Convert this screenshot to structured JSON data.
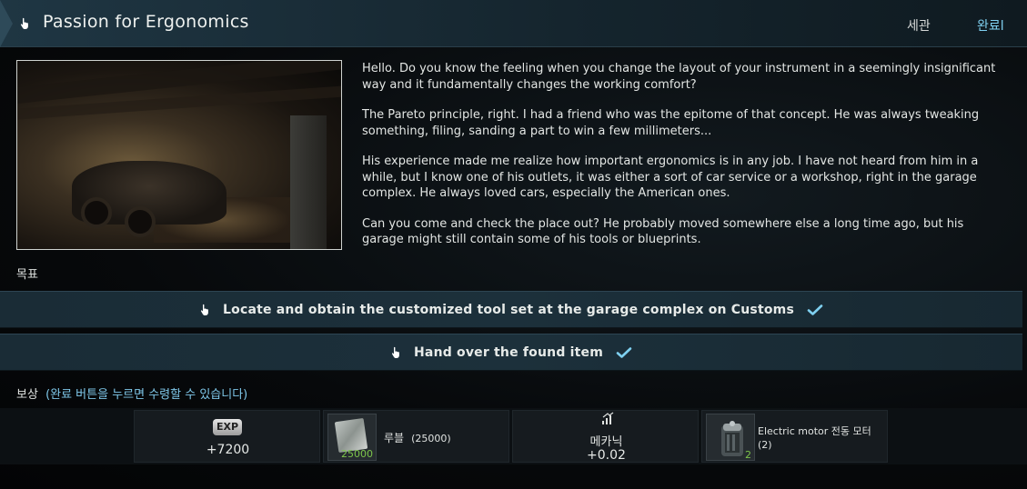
{
  "header": {
    "title": "Passion for Ergonomics",
    "decline_label": "세관",
    "complete_label": "완료l"
  },
  "description": {
    "paragraphs": [
      "Hello. Do you know the feeling when you change the layout of your instrument in a seemingly insignificant way and it fundamentally changes the working comfort?",
      "The Pareto principle, right. I had a friend who was the epitome of that concept. He was always tweaking something, filing, sanding a part to win a few millimeters...",
      "His experience made me realize how important ergonomics is in any job. I have not heard from him in a while, but I know one of his outlets, it was either a sort of car service or a workshop, right in the garage complex. He always loved cars, especially the American ones.",
      "Can you come and check the place out? He probably moved somewhere else a long time ago, but his garage might still contain some of his tools or blueprints."
    ]
  },
  "objectives": {
    "label": "목표",
    "items": [
      {
        "text": "Locate and obtain the customized tool set at the garage complex on Customs",
        "completed": true
      },
      {
        "text": "Hand over the found item",
        "completed": true
      }
    ]
  },
  "rewards": {
    "label": "보상",
    "note": "(완료 버튼을 누르면 수령할 수 있습니다)",
    "exp": {
      "badge": "EXP",
      "value": "+7200"
    },
    "money": {
      "count": "25000",
      "label": "루블",
      "amount": "(25000)"
    },
    "skill": {
      "name": "메카닉",
      "value": "+0.02"
    },
    "item": {
      "name": "Electric motor 전동 모터",
      "quantity": "(2)",
      "count": "2"
    }
  },
  "colors": {
    "accent": "#7fd0f0",
    "header_bg": "#1f3643",
    "objective_bg": "#1c303b",
    "count_green": "#7cc44a"
  }
}
